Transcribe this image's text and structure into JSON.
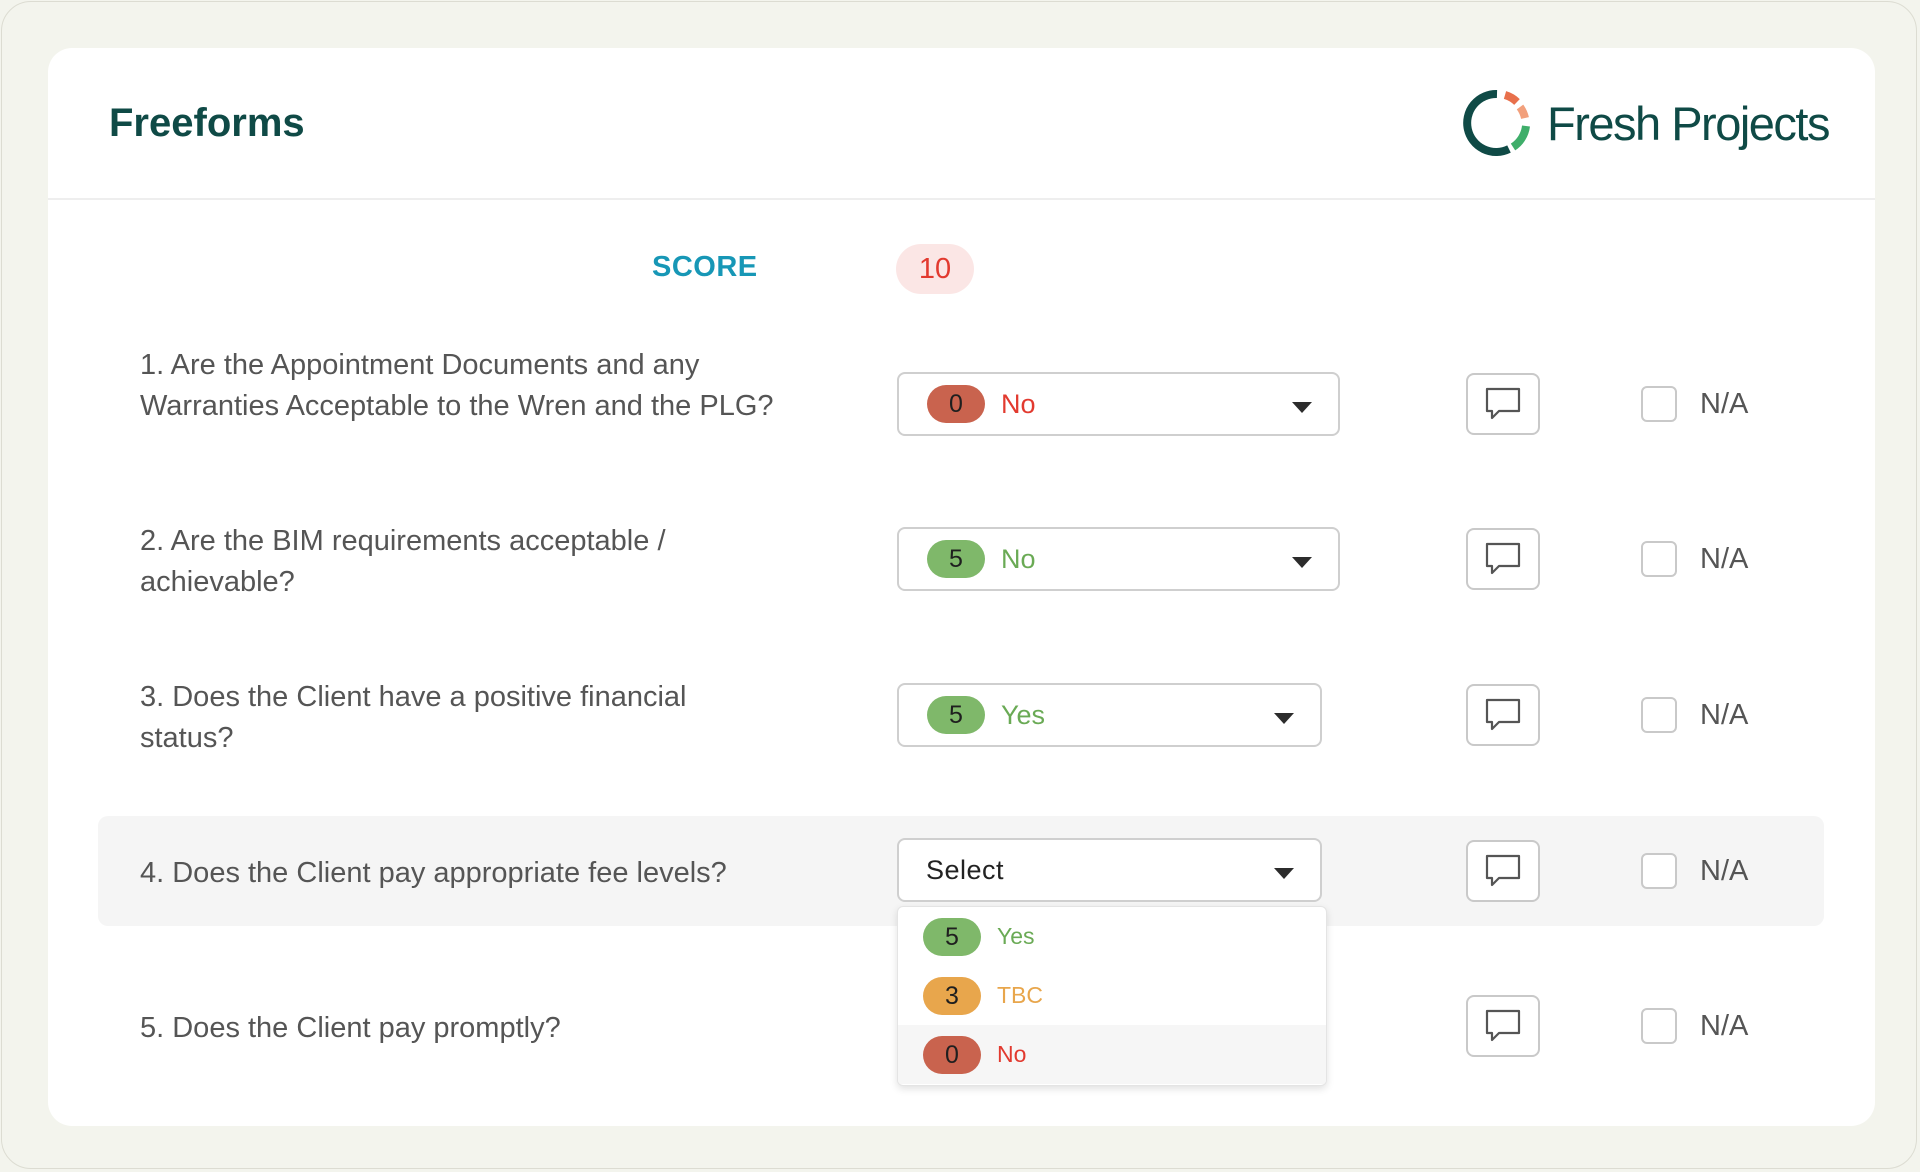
{
  "header": {
    "title": "Freeforms",
    "logo_text": "Fresh Projects"
  },
  "score": {
    "label": "SCORE",
    "value": "10"
  },
  "colors": {
    "green": "#7fb86a",
    "orange": "#e8a64c",
    "red": "#c9634e"
  },
  "questions": [
    {
      "text": "1. Are the Appointment Documents and any Warranties Acceptable to the Wren and the PLG?",
      "score": "0",
      "answer": "No",
      "badge_color": "#c9634e",
      "label_color": "#e23a2f",
      "na_label": "N/A"
    },
    {
      "text": "2. Are the BIM requirements acceptable / achievable?",
      "score": "5",
      "answer": "No",
      "badge_color": "#7fb86a",
      "label_color": "#6aaa55",
      "na_label": "N/A"
    },
    {
      "text": "3. Does the Client have a positive financial status?",
      "score": "5",
      "answer": "Yes",
      "badge_color": "#7fb86a",
      "label_color": "#6aaa55",
      "na_label": "N/A"
    },
    {
      "text": "4. Does the Client pay appropriate fee levels?",
      "placeholder": "Select",
      "na_label": "N/A"
    },
    {
      "text": "5. Does the Client pay promptly?",
      "na_label": "N/A"
    }
  ],
  "dropdown_options": [
    {
      "score": "5",
      "label": "Yes",
      "badge_color": "#7fb86a",
      "label_color": "#6aaa55"
    },
    {
      "score": "3",
      "label": "TBC",
      "badge_color": "#e8a64c",
      "label_color": "#e8a64c"
    },
    {
      "score": "0",
      "label": "No",
      "badge_color": "#c9634e",
      "label_color": "#e23a2f"
    }
  ]
}
